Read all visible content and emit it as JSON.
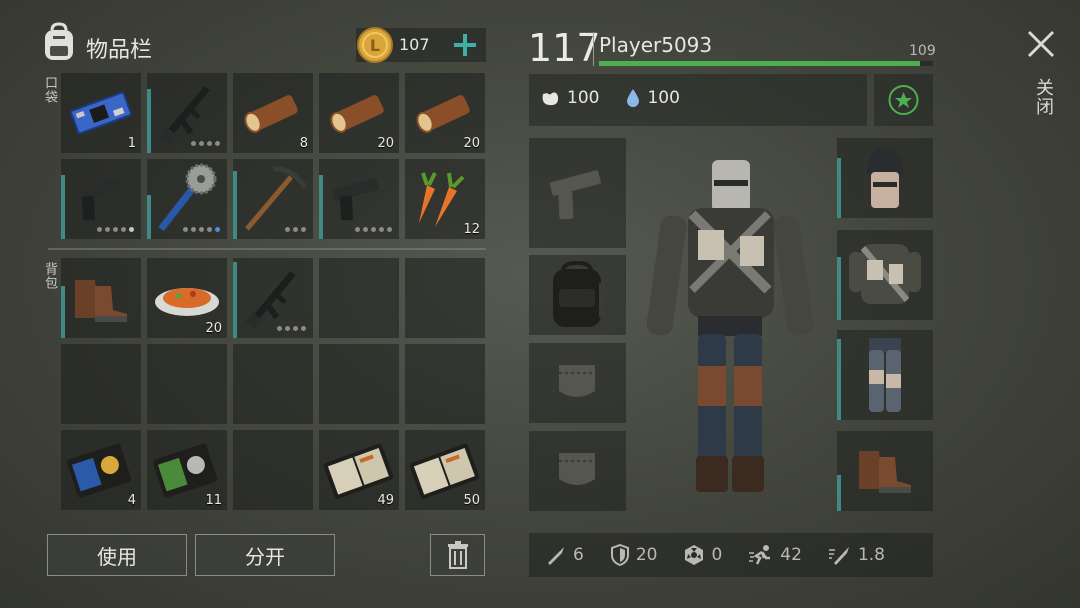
{
  "inventory": {
    "title": "物品栏",
    "coins": "107",
    "pockets_label": "口袋",
    "backpack_label": "背包"
  },
  "slots": {
    "p0_count": "1",
    "p3_count": "8",
    "p4_count": "20",
    "p5_count": "20",
    "p9_count": "12",
    "b1_count": "20",
    "b10_count": "4",
    "b11_count": "11",
    "b13_count": "49",
    "b14_count": "50"
  },
  "buttons": {
    "use": "使用",
    "split": "分开"
  },
  "player": {
    "level": "117",
    "name": "Player5093",
    "xp_value": "109",
    "xp_fraction": 0.96,
    "food": "100",
    "water": "100"
  },
  "stats": {
    "attack": "6",
    "defense": "20",
    "radiation": "0",
    "speed": "42",
    "attack_speed": "1.8"
  },
  "close_label": "关闭",
  "colors": {
    "accent": "#3fb0a6",
    "xp_bar": "#4caf50",
    "durability": "#3f8a86",
    "coin": "#d9a53a"
  }
}
